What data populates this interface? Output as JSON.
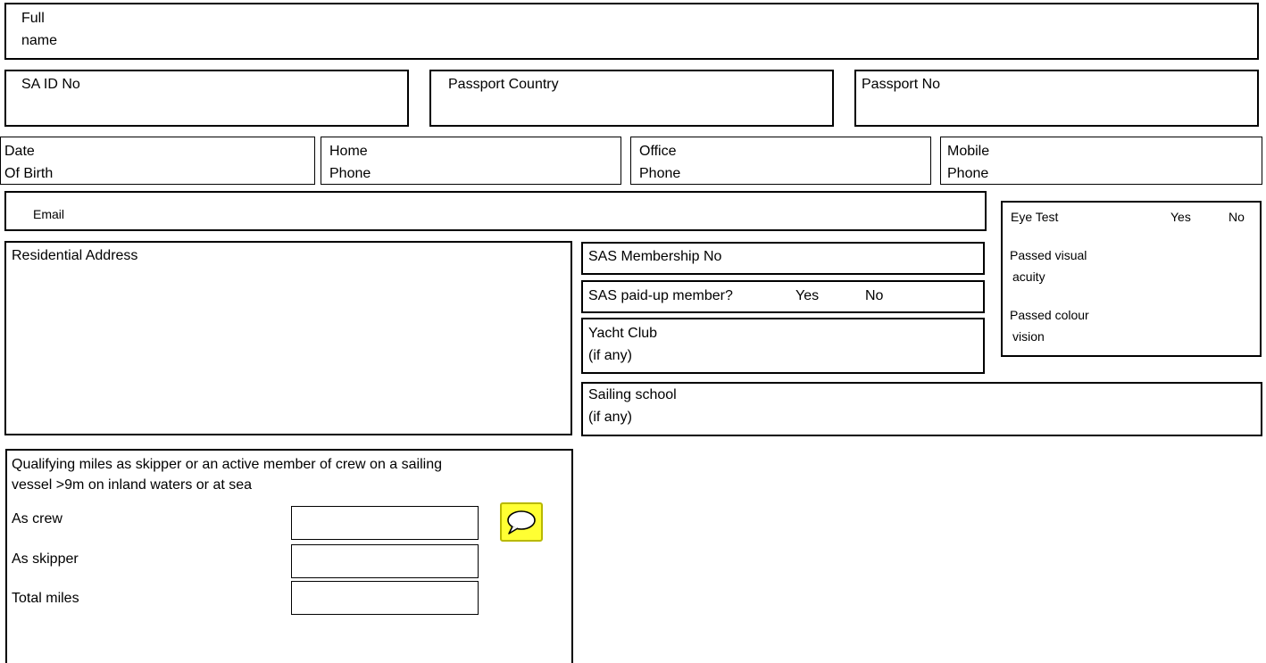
{
  "row1": {
    "full_name_line1": "Full",
    "full_name_line2": "name"
  },
  "row2": {
    "sa_id": "SA ID No",
    "passport_country": "Passport Country",
    "passport_no": "Passport No"
  },
  "row3": {
    "dob_line1": "Date",
    "dob_line2": "Of Birth",
    "home_line1": "Home",
    "home_line2": "Phone",
    "office_line1": "Office",
    "office_line2": "Phone",
    "mobile_line1": "Mobile",
    "mobile_line2": "Phone"
  },
  "email": "Email",
  "eye_test": {
    "title": "Eye Test",
    "yes": "Yes",
    "no": "No",
    "visual_line1": "Passed visual",
    "visual_line2": "acuity",
    "colour_line1": "Passed colour",
    "colour_line2": "vision"
  },
  "residential_address": "Residential Address",
  "sas": {
    "membership_no": "SAS Membership No",
    "paid_up": "SAS paid-up member?",
    "yes": "Yes",
    "no": "No"
  },
  "yacht_club": {
    "line1": "Yacht Club",
    "line2": "(if any)"
  },
  "sailing_school": {
    "line1": "Sailing school",
    "line2": "(if any)"
  },
  "miles": {
    "heading_line1": "Qualifying miles as skipper or an active member of crew on a sailing",
    "heading_line2": "vessel >9m on inland waters or at sea",
    "crew": "As crew",
    "skipper": "As skipper",
    "total": "Total miles"
  },
  "icons": {
    "comment": "comment-bubble-icon"
  },
  "colors": {
    "comment_icon_bg": "#ffff33"
  }
}
